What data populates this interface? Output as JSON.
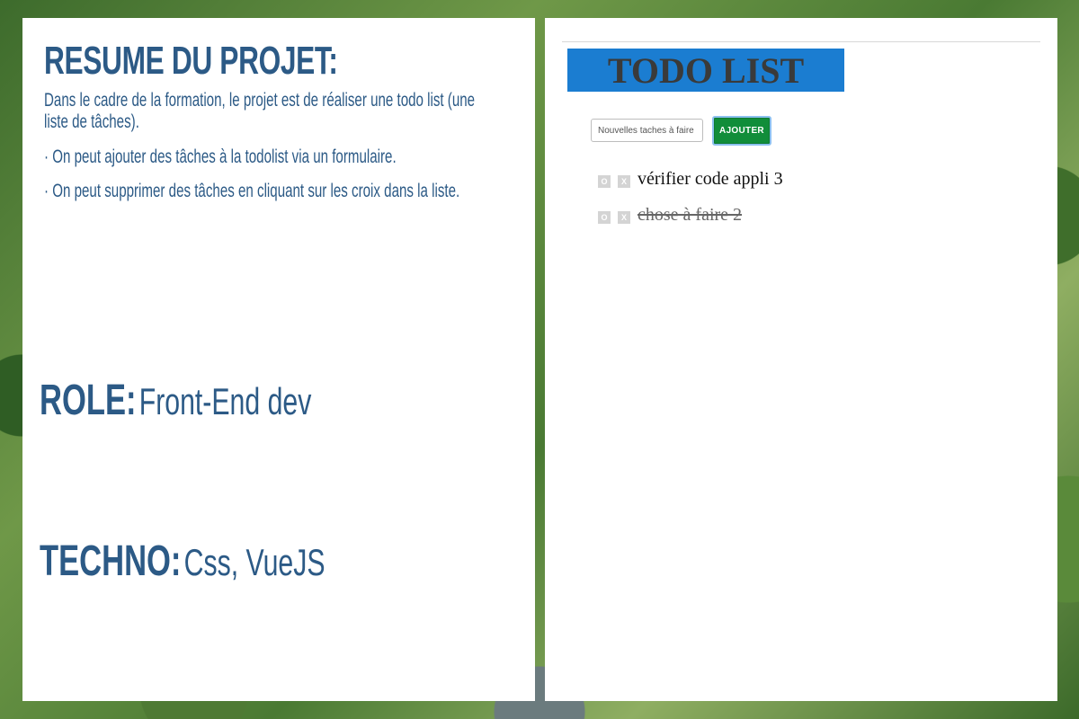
{
  "summary": {
    "title": "RESUME DU PROJET:",
    "description": "Dans le cadre de la formation, le projet est de réaliser une todo list (une liste de tâches).",
    "bullets": [
      "· On peut ajouter des tâches à la todolist via un formulaire.",
      "· On peut supprimer des tâches en cliquant sur les croix dans la liste."
    ]
  },
  "role": {
    "label": "ROLE:",
    "value": "Front-End dev"
  },
  "techno": {
    "label": "TECHNO:",
    "value": "Css, VueJS"
  },
  "app": {
    "title": "TODO LIST",
    "input_placeholder": "Nouvelles taches à faire",
    "add_label": "AJOUTER",
    "toggle_label": "O",
    "delete_label": "X",
    "todos": [
      {
        "text": "vérifier code appli 3",
        "done": false
      },
      {
        "text": "chose à faire 2",
        "done": true
      }
    ]
  },
  "colors": {
    "heading_blue": "#2c5a86",
    "banner_blue": "#1b7dd1",
    "button_green": "#118d3a"
  }
}
